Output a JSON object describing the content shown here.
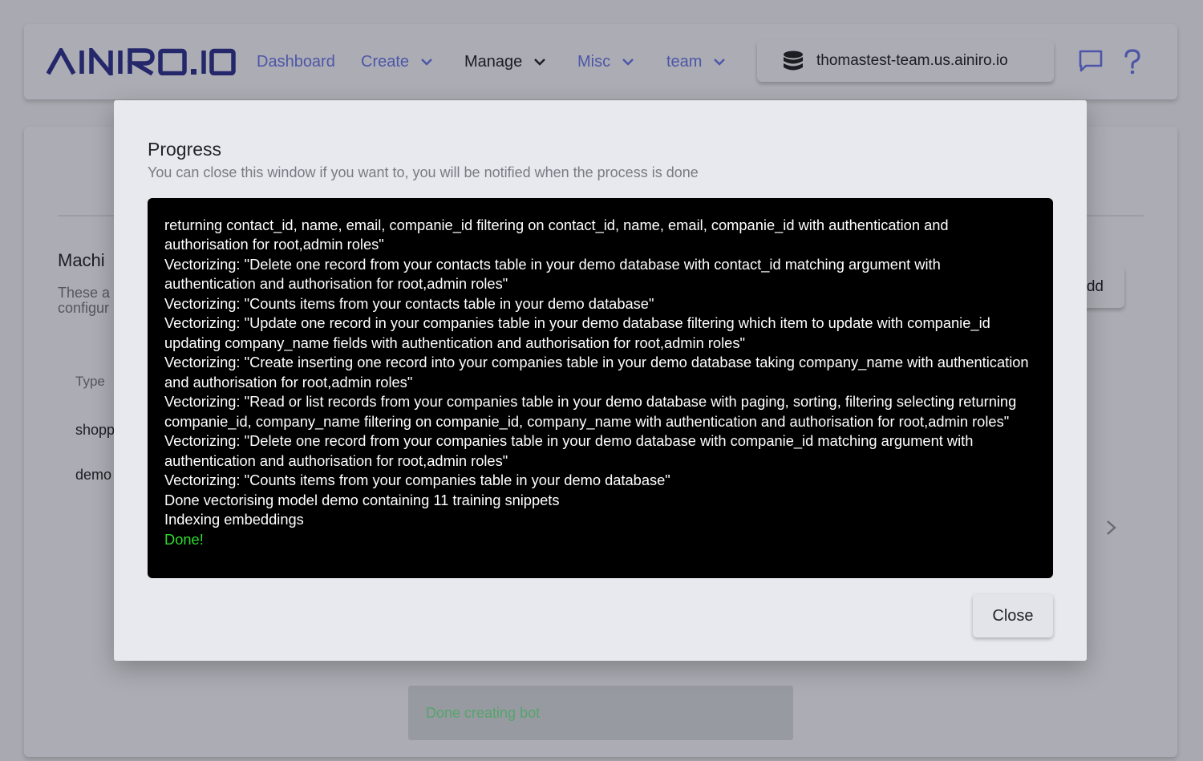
{
  "header": {
    "logo_text": "AINIRO.IO",
    "nav": [
      {
        "label": "Dashboard",
        "has_dropdown": false
      },
      {
        "label": "Create",
        "has_dropdown": true
      },
      {
        "label": "Manage",
        "has_dropdown": true
      },
      {
        "label": "Misc",
        "has_dropdown": true
      },
      {
        "label": "team",
        "has_dropdown": true
      }
    ],
    "server": "thomastest-team.us.ainiro.io",
    "icons": [
      "database-icon",
      "chat-icon",
      "help-icon"
    ]
  },
  "background": {
    "section_title": "Machi",
    "section_desc_1": "These a",
    "section_desc_2": "configur",
    "add_button": "dd",
    "table_header": "Type",
    "rows": [
      "shopp",
      "demo"
    ]
  },
  "toast": {
    "message": "Done creating bot"
  },
  "modal": {
    "title": "Progress",
    "subtitle": "You can close this window if you want to, you will be notified when the process is done",
    "log_lines": [
      "returning contact_id, name, email, companie_id filtering on contact_id, name, email, companie_id with authentication and authorisation for root,admin roles\"",
      "Vectorizing: \"Delete one record from your contacts table in your demo database with contact_id matching argument with authentication and authorisation for root,admin roles\"",
      "Vectorizing: \"Counts items from your contacts table in your demo database\"",
      "Vectorizing: \"Update one record in your companies table in your demo database filtering which item to update with companie_id updating company_name fields with authentication and authorisation for root,admin roles\"",
      "Vectorizing: \"Create inserting one record into your companies table in your demo database taking company_name with authentication and authorisation for root,admin roles\"",
      "Vectorizing: \"Read or list records from your companies table in your demo database with paging, sorting, filtering selecting returning companie_id, company_name filtering on companie_id, company_name with authentication and authorisation for root,admin roles\"",
      "Vectorizing: \"Delete one record from your companies table in your demo database with companie_id matching argument with authentication and authorisation for root,admin roles\"",
      "Vectorizing: \"Counts items from your companies table in your demo database\"",
      "Done vectorising model demo containing 11 training snippets",
      "Indexing embeddings"
    ],
    "done_line": "Done!",
    "done_color": "#2ddc2d",
    "close_label": "Close"
  },
  "colors": {
    "nav_link": "#4d55a8",
    "console_bg": "#000000",
    "console_text": "#ffffff"
  }
}
